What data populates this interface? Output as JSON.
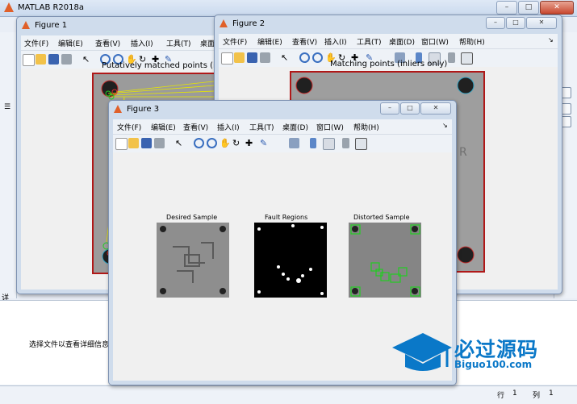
{
  "app": {
    "title": "MATLAB R2018a"
  },
  "main": {
    "detail_text": "选择文件以查看详细信息",
    "left_tab_glyph": "详",
    "status": {
      "row_label": "行",
      "row_value": "1",
      "col_label": "列",
      "col_value": "1"
    }
  },
  "figures": [
    {
      "title": "Figure 1",
      "axes_title": "Putatively matched points (inl"
    },
    {
      "title": "Figure 2",
      "axes_title": "Matching points (inliers only)"
    },
    {
      "title": "Figure 3",
      "panels": [
        {
          "title": "Desired Sample"
        },
        {
          "title": "Fault Regions"
        },
        {
          "title": "Distorted Sample"
        }
      ]
    }
  ],
  "menu": [
    "文件(F)",
    "编辑(E)",
    "查看(V)",
    "插入(I)",
    "工具(T)",
    "桌面(D)",
    "窗口(W)",
    "帮助(H)"
  ],
  "window_buttons": {
    "minimize": "–",
    "maximize": "□",
    "close": "✕"
  },
  "watermark": {
    "name": "必过源码",
    "url": "Biguo100.com"
  },
  "colors": {
    "accent": "#0a78c8",
    "figure_border": "#b01818",
    "match_lines": "#e6e600",
    "detected": "#22cc22"
  }
}
